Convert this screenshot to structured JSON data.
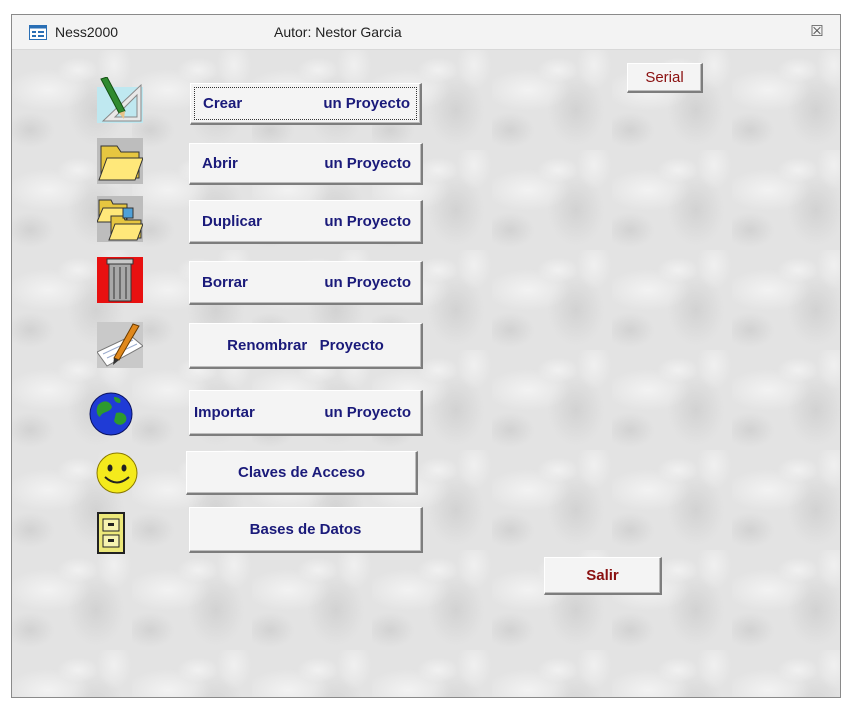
{
  "window": {
    "app_name": "Ness2000",
    "author": "Autor: Nestor Garcia",
    "close_glyph": "☒"
  },
  "buttons": {
    "serial": "Serial",
    "crear": {
      "verb": "Crear",
      "rest": "un Proyecto"
    },
    "abrir": {
      "verb": "Abrir",
      "rest": "un Proyecto"
    },
    "duplicar": {
      "verb": "Duplicar",
      "rest": "un Proyecto"
    },
    "borrar": {
      "verb": "Borrar",
      "rest": "un Proyecto"
    },
    "renombrar": "Renombrar   Proyecto",
    "importar": {
      "verb": "Importar",
      "rest": "un Proyecto"
    },
    "claves": "Claves de Acceso",
    "bases": "Bases de Datos",
    "salir": "Salir"
  },
  "icons": [
    "pencil-ruler-icon",
    "folder-icon",
    "duplicate-folders-icon",
    "trash-can-icon",
    "paper-pencil-icon",
    "globe-icon",
    "smiley-icon",
    "file-cabinet-icon"
  ],
  "colors": {
    "button_text": "#1a1a7a",
    "exit_text": "#8a1010"
  }
}
